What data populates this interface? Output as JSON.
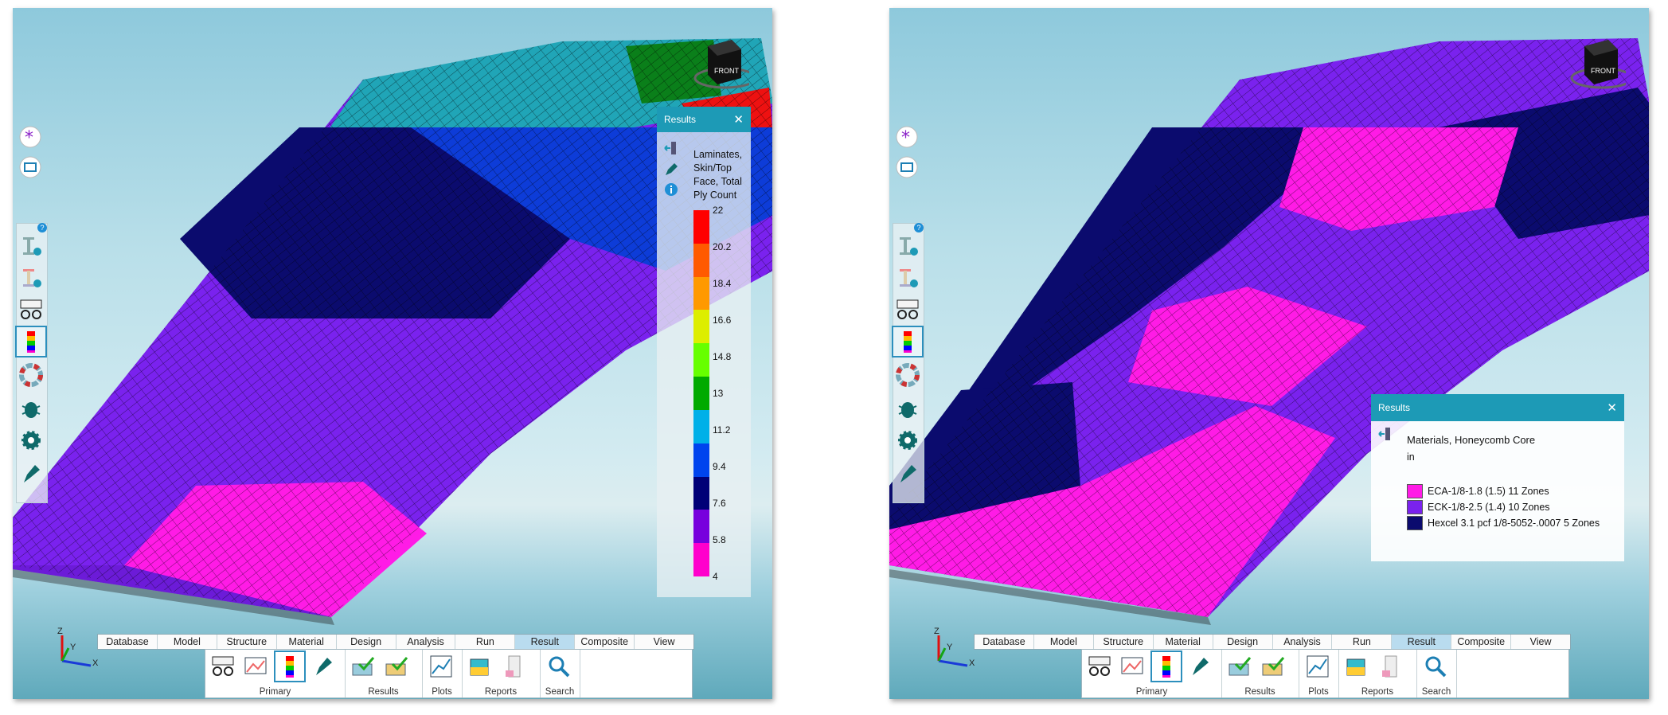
{
  "panels": [
    {
      "id": "left",
      "results": {
        "header": "Results",
        "title": "Laminates, Skin/Top Face, Total Ply Count",
        "ticks": [
          "22",
          "20.2",
          "18.4",
          "16.6",
          "14.8",
          "13",
          "11.2",
          "9.4",
          "7.6",
          "5.8",
          "4"
        ],
        "colors": [
          "#ff0000",
          "#ff5a00",
          "#ff9900",
          "#ddee00",
          "#66ff00",
          "#00aa00",
          "#00b0e8",
          "#0044ee",
          "#000077",
          "#7700dd",
          "#ff00cc"
        ]
      }
    },
    {
      "id": "right",
      "results": {
        "header": "Results",
        "title": "Materials, Honeycomb Core",
        "unit": "in",
        "legend": [
          {
            "label": "ECA-1/8-1.8 (1.5) 11 Zones",
            "color": "#ff1be6"
          },
          {
            "label": "ECK-1/8-2.5 (1.4) 10 Zones",
            "color": "#7a22ee"
          },
          {
            "label": "Hexcel 3.1 pcf 1/8-5052-.0007 5 Zones",
            "color": "#0b0b6e"
          }
        ]
      }
    }
  ],
  "viewcube": {
    "face_label": "FRONT"
  },
  "axes": {
    "x": "X",
    "y": "Y",
    "z": "Z"
  },
  "tabs": [
    "Database",
    "Model",
    "Structure",
    "Material",
    "Design",
    "Analysis",
    "Run",
    "Result",
    "Composite",
    "View"
  ],
  "active_tab": "Result",
  "ribbon_groups": [
    "Primary",
    "Results",
    "Plots",
    "Reports",
    "Search"
  ],
  "sidebar_icons": [
    "asterisk-icon",
    "window-icon",
    "ibeam-play-icon",
    "ibeam-check-icon",
    "glasses-icon",
    "colorbar-icon",
    "color-wheel-icon",
    "bug-icon",
    "gear-icon",
    "pen-icon"
  ],
  "colors": {
    "accent": "#1d9ab6",
    "tab_active": "#b9dcef"
  }
}
